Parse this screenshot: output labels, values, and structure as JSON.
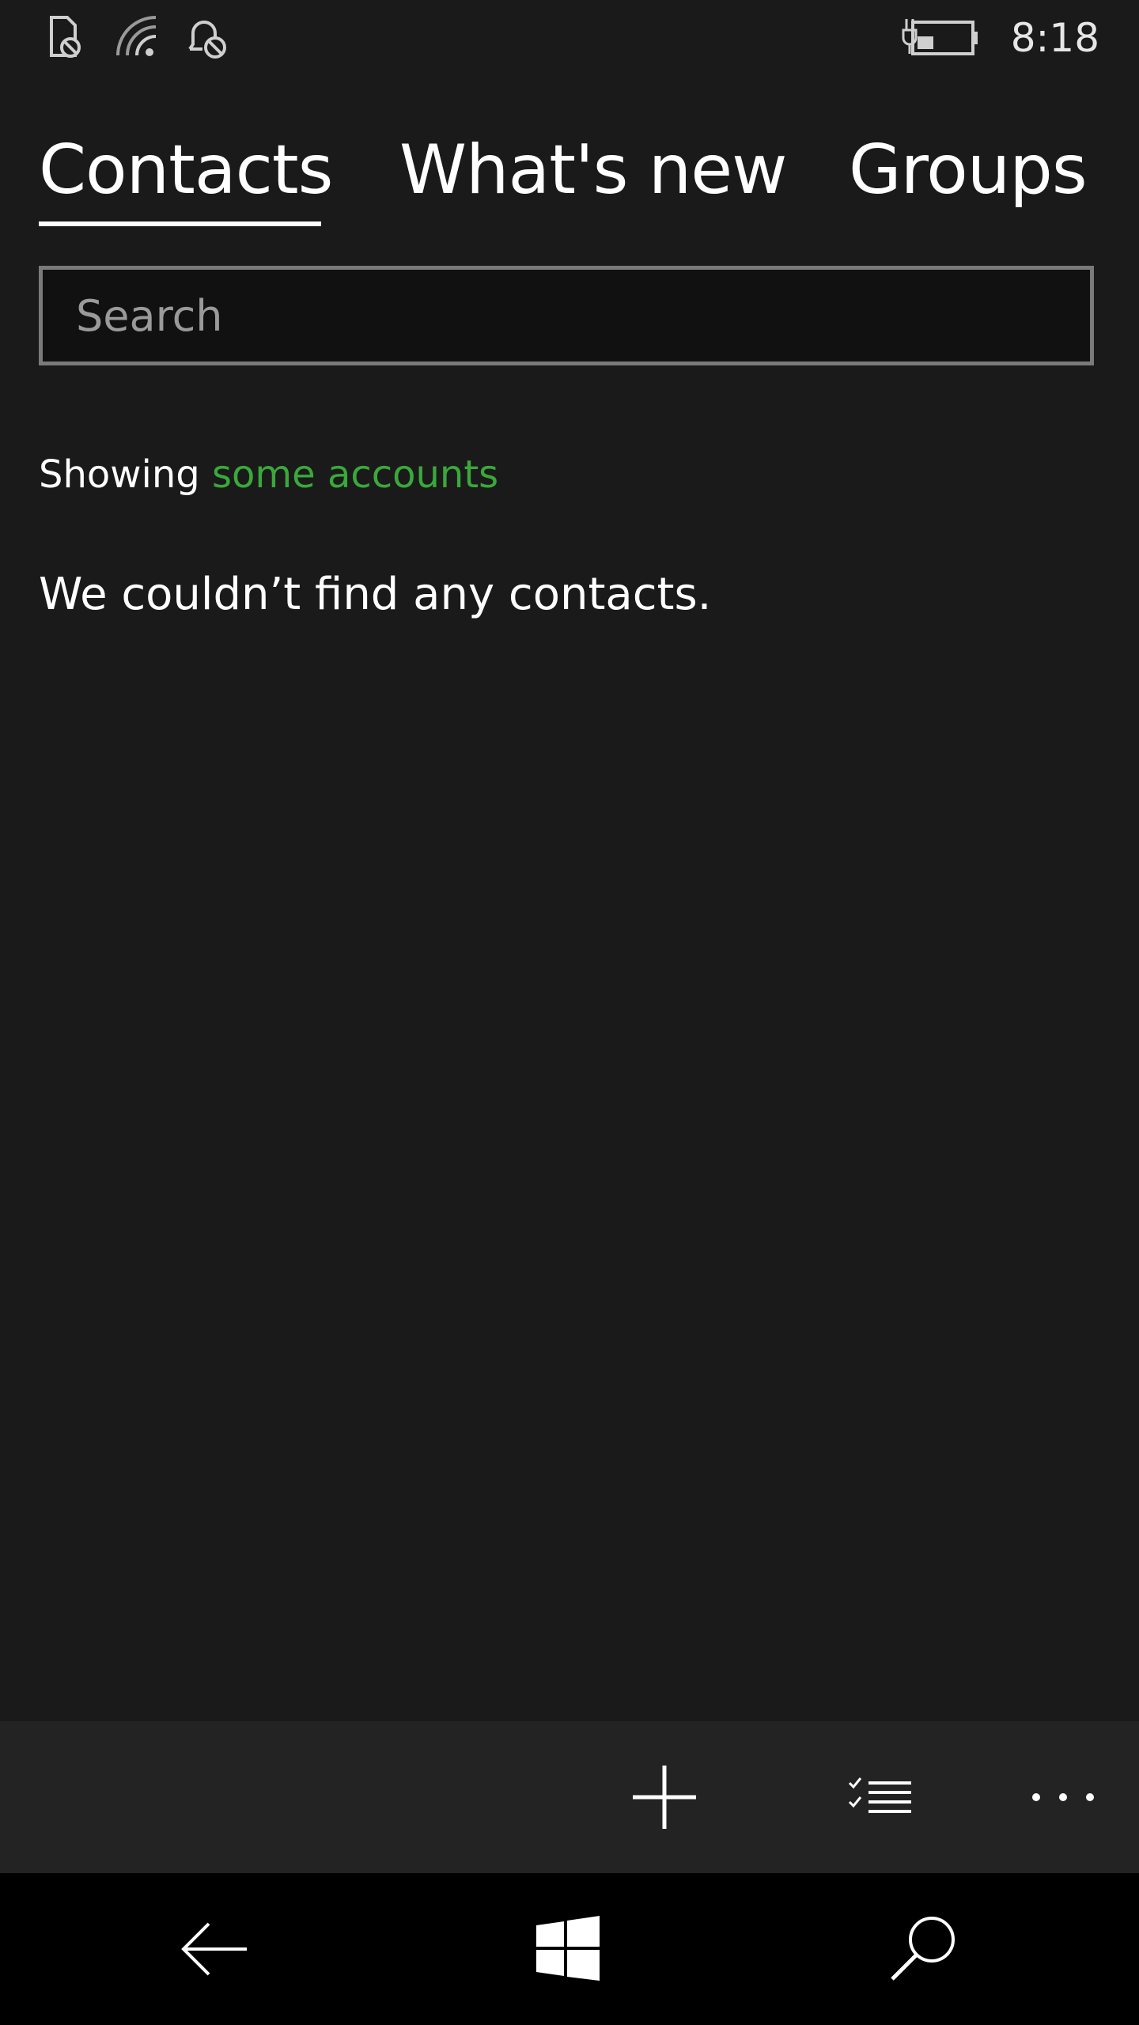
{
  "status_bar": {
    "icons": [
      "no-sim-icon",
      "wifi-signal-icon",
      "quiet-hours-icon",
      "battery-charging-icon"
    ],
    "time": "8:18"
  },
  "pivot": {
    "tabs": [
      {
        "label": "Contacts",
        "selected": true
      },
      {
        "label": "What's new",
        "selected": false
      },
      {
        "label": "Groups",
        "selected": false
      }
    ]
  },
  "search": {
    "placeholder": "Search",
    "value": ""
  },
  "content": {
    "showing_prefix": "Showing",
    "showing_link": "some accounts",
    "empty_message": "We couldn’t find any contacts."
  },
  "app_bar": {
    "buttons": [
      "add-icon",
      "select-list-icon",
      "more-icon"
    ]
  },
  "nav_bar": {
    "buttons": [
      "back-icon",
      "windows-start-icon",
      "search-icon"
    ]
  },
  "colors": {
    "background": "#1a1a1a",
    "accent": "#3aa83a",
    "app_bar": "#232323",
    "nav_bar": "#000000"
  }
}
